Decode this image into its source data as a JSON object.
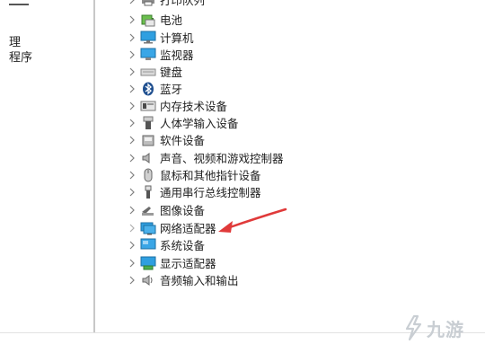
{
  "left_pane": {
    "items": [
      {
        "label": "理"
      },
      {
        "label": "程序"
      }
    ]
  },
  "device_tree": {
    "items": [
      {
        "label": "打印队列",
        "icon": "printer-icon"
      },
      {
        "label": "电池",
        "icon": "battery-icon"
      },
      {
        "label": "计算机",
        "icon": "computer-monitor-icon"
      },
      {
        "label": "监视器",
        "icon": "monitor-icon"
      },
      {
        "label": "键盘",
        "icon": "keyboard-icon"
      },
      {
        "label": "蓝牙",
        "icon": "bluetooth-icon"
      },
      {
        "label": "内存技术设备",
        "icon": "memory-card-icon"
      },
      {
        "label": "人体学输入设备",
        "icon": "hid-icon"
      },
      {
        "label": "软件设备",
        "icon": "software-device-icon"
      },
      {
        "label": "声音、视频和游戏控制器",
        "icon": "speaker-icon"
      },
      {
        "label": "鼠标和其他指针设备",
        "icon": "mouse-icon"
      },
      {
        "label": "通用串行总线控制器",
        "icon": "usb-icon"
      },
      {
        "label": "图像设备",
        "icon": "camera-icon"
      },
      {
        "label": "网络适配器",
        "icon": "network-adapter-icon"
      },
      {
        "label": "系统设备",
        "icon": "system-device-icon"
      },
      {
        "label": "显示适配器",
        "icon": "display-adapter-icon"
      },
      {
        "label": "音频输入和输出",
        "icon": "audio-io-icon"
      }
    ]
  },
  "annotation": {
    "color": "#e03a3a"
  },
  "watermark": {
    "text": "九游"
  }
}
